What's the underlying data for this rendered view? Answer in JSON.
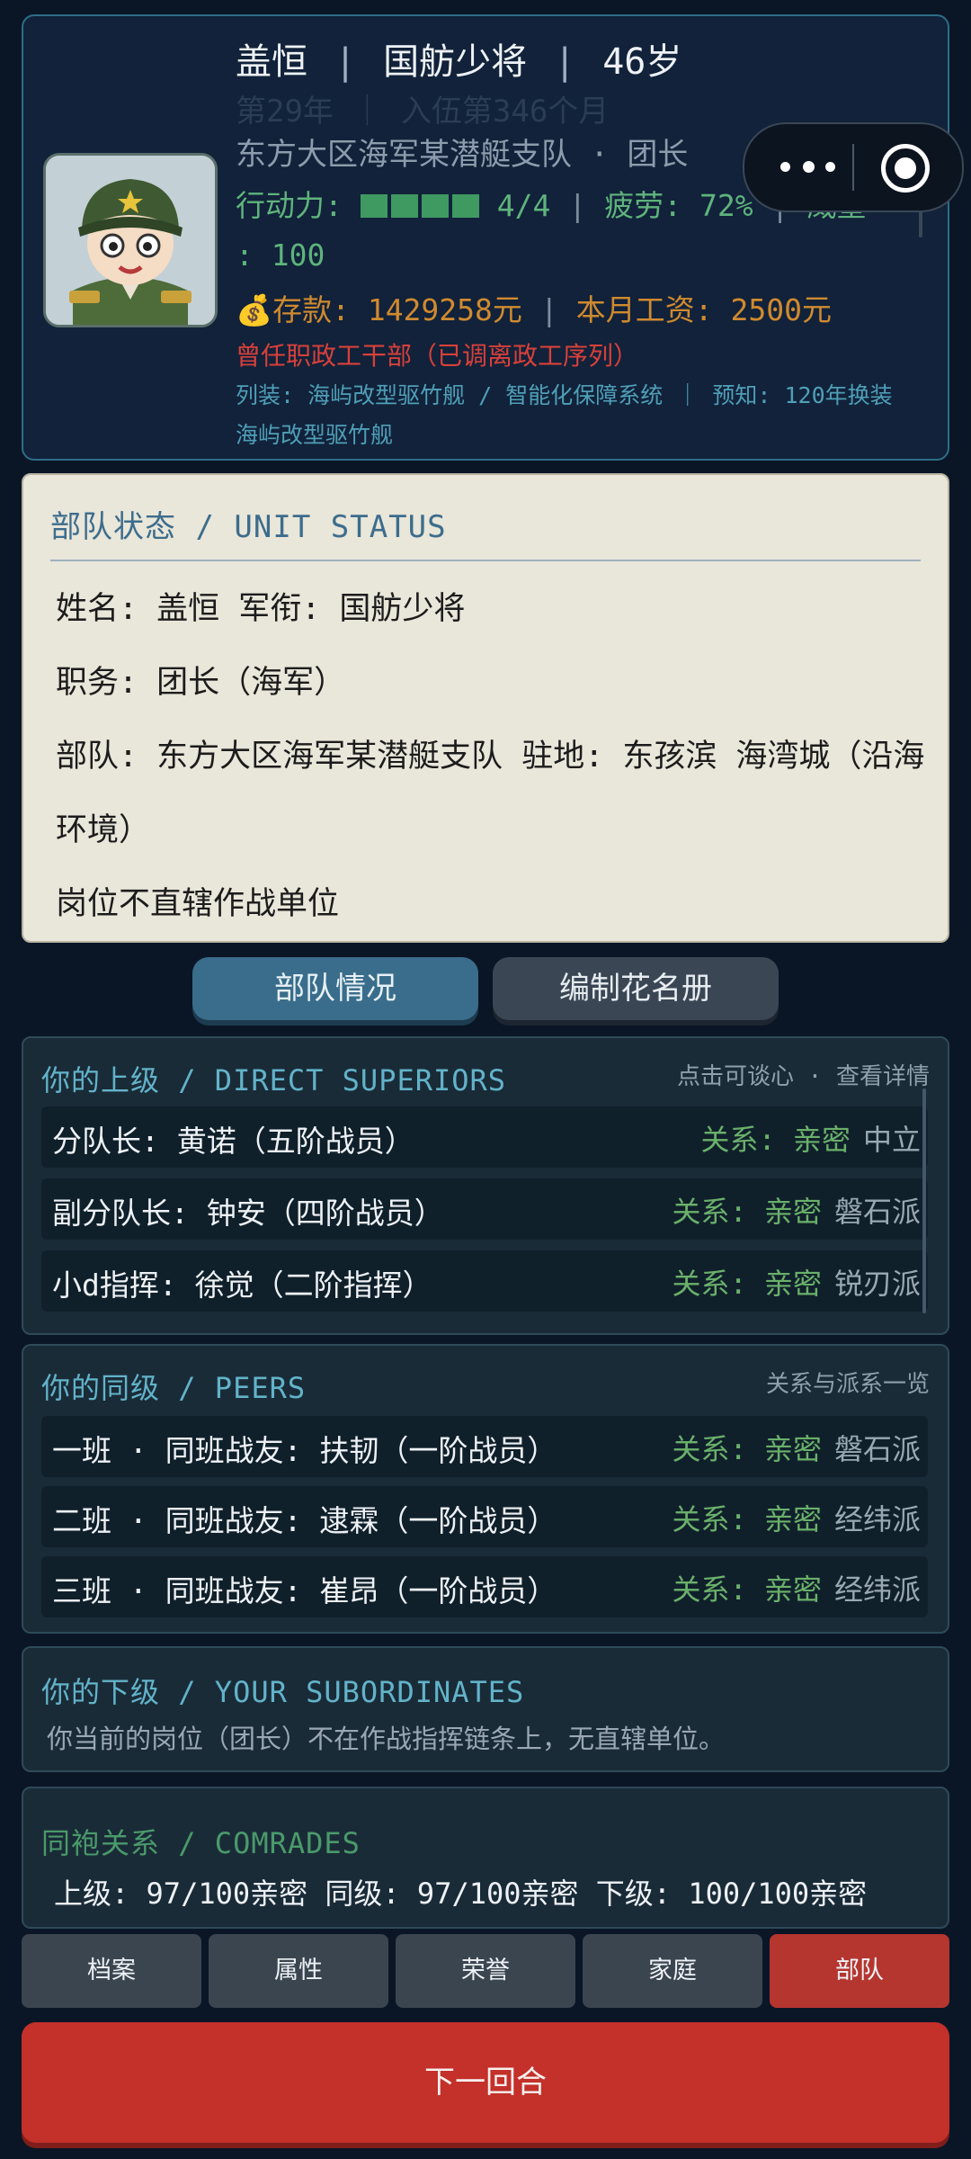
{
  "header": {
    "name": "盖恒",
    "rank": "国舫少将",
    "age": "46岁",
    "service_line": "第29年 ｜ 入伍第346个月",
    "unit_line": "东方大区海军某潜艇支队 · 团长",
    "action_label": "行动力:",
    "action_value": "4/4",
    "action_fraction": 1.0,
    "fatigue": "疲劳: 72%",
    "prestige_label": "威望",
    "prestige_value": ": 100",
    "money": "💰存款: 1429258元",
    "salary": "本月工资: 2500元",
    "former_role": "曾任职政工干部（已调离政工序列）",
    "equipment": "列装: 海屿改型驱竹舰 / 智能化保障系统 ｜ 预知: 120年换装 海屿改型驱竹舰"
  },
  "unit_status": {
    "title": "部队状态 / UNIT STATUS",
    "line1": "姓名: 盖恒  军衔: 国舫少将",
    "line2": "职务: 团长（海军）",
    "line3": "部队: 东方大区海军某潜艇支队  驻地: 东孩滨 海湾城（沿海",
    "line3b": "环境）",
    "line4": "岗位不直辖作战单位"
  },
  "tabs": {
    "unit": "部队情况",
    "roster": "编制花名册"
  },
  "superiors": {
    "title": "你的上级 / DIRECT SUPERIORS",
    "hint": "点击可谈心 · 查看详情",
    "rows": [
      {
        "text": "分队长: 黄诺（五阶战员）",
        "rel": "关系: 亲密",
        "faction": "中立"
      },
      {
        "text": "副分队长: 钟安（四阶战员）",
        "rel": "关系: 亲密",
        "faction": "磐石派"
      },
      {
        "text": "小d指挥: 徐觉（二阶指挥）",
        "rel": "关系: 亲密",
        "faction": "锐刃派"
      }
    ]
  },
  "peers": {
    "title": "你的同级 / PEERS",
    "hint": "关系与派系一览",
    "rows": [
      {
        "text": "一班 · 同班战友: 扶韧（一阶战员）",
        "rel": "关系: 亲密",
        "faction": "磐石派"
      },
      {
        "text": "二班 · 同班战友: 逮霖（一阶战员）",
        "rel": "关系: 亲密",
        "faction": "经纬派"
      },
      {
        "text": "三班 · 同班战友: 崔昂（一阶战员）",
        "rel": "关系: 亲密",
        "faction": "经纬派"
      }
    ]
  },
  "subordinates": {
    "title": "你的下级 / YOUR SUBORDINATES",
    "text": "你当前的岗位（团长）不在作战指挥链条上，无直辖单位。"
  },
  "comrades": {
    "title": "同袍关系 / COMRADES",
    "text": "上级: 97/100亲密  同级: 97/100亲密  下级: 100/100亲密"
  },
  "nav": {
    "items": [
      "档案",
      "属性",
      "荣誉",
      "家庭",
      "部队"
    ],
    "active_index": 4
  },
  "next_turn": "下一回合",
  "colors": {
    "accent_cyan": "#62b3c9",
    "relation_green": "#6ab06a",
    "warning_red": "#d8403a",
    "money_orange": "#d08a2f",
    "nav_active": "#b5352f"
  },
  "icons": {
    "capsule_left": "more-dots-icon",
    "capsule_right": "target-icon",
    "money": "money-bag-icon"
  }
}
